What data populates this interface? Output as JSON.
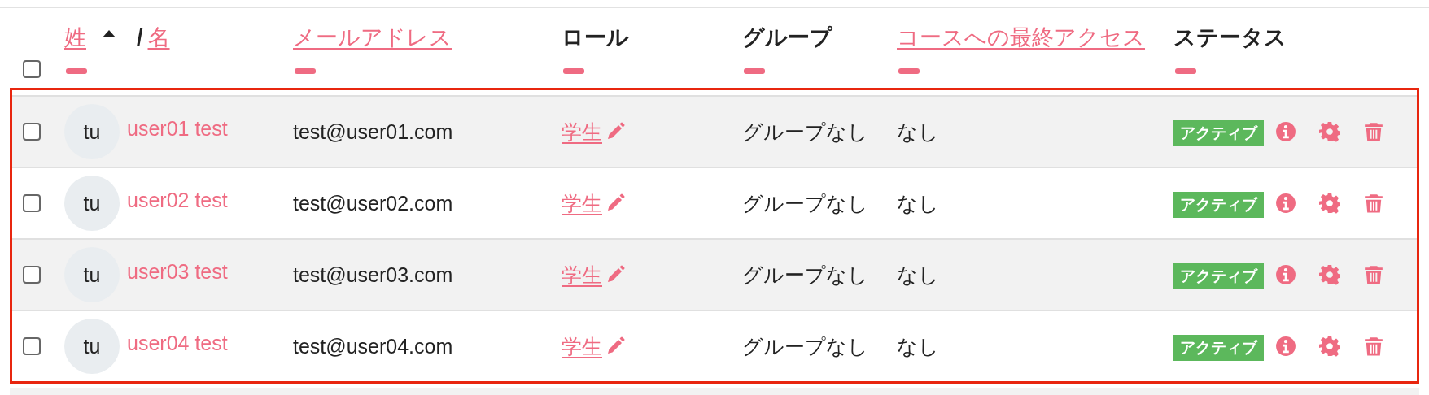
{
  "header": {
    "select_all": {
      "checked": false
    },
    "last_name": "姓",
    "separator": "/",
    "first_name": "名",
    "email": "メールアドレス",
    "role": "ロール",
    "group": "グループ",
    "last_access": "コースへの最終アクセス",
    "status": "ステータス"
  },
  "rows": [
    {
      "checked": false,
      "initials": "tu",
      "name": "user01 test",
      "email": "test@user01.com",
      "role": "学生",
      "group": "グループなし",
      "last_access": "なし",
      "status": "アクティブ"
    },
    {
      "checked": false,
      "initials": "tu",
      "name": "user02 test",
      "email": "test@user02.com",
      "role": "学生",
      "group": "グループなし",
      "last_access": "なし",
      "status": "アクティブ"
    },
    {
      "checked": false,
      "initials": "tu",
      "name": "user03 test",
      "email": "test@user03.com",
      "role": "学生",
      "group": "グループなし",
      "last_access": "なし",
      "status": "アクティブ"
    },
    {
      "checked": false,
      "initials": "tu",
      "name": "user04 test",
      "email": "test@user04.com",
      "role": "学生",
      "group": "グループなし",
      "last_access": "なし",
      "status": "アクティブ"
    }
  ]
}
